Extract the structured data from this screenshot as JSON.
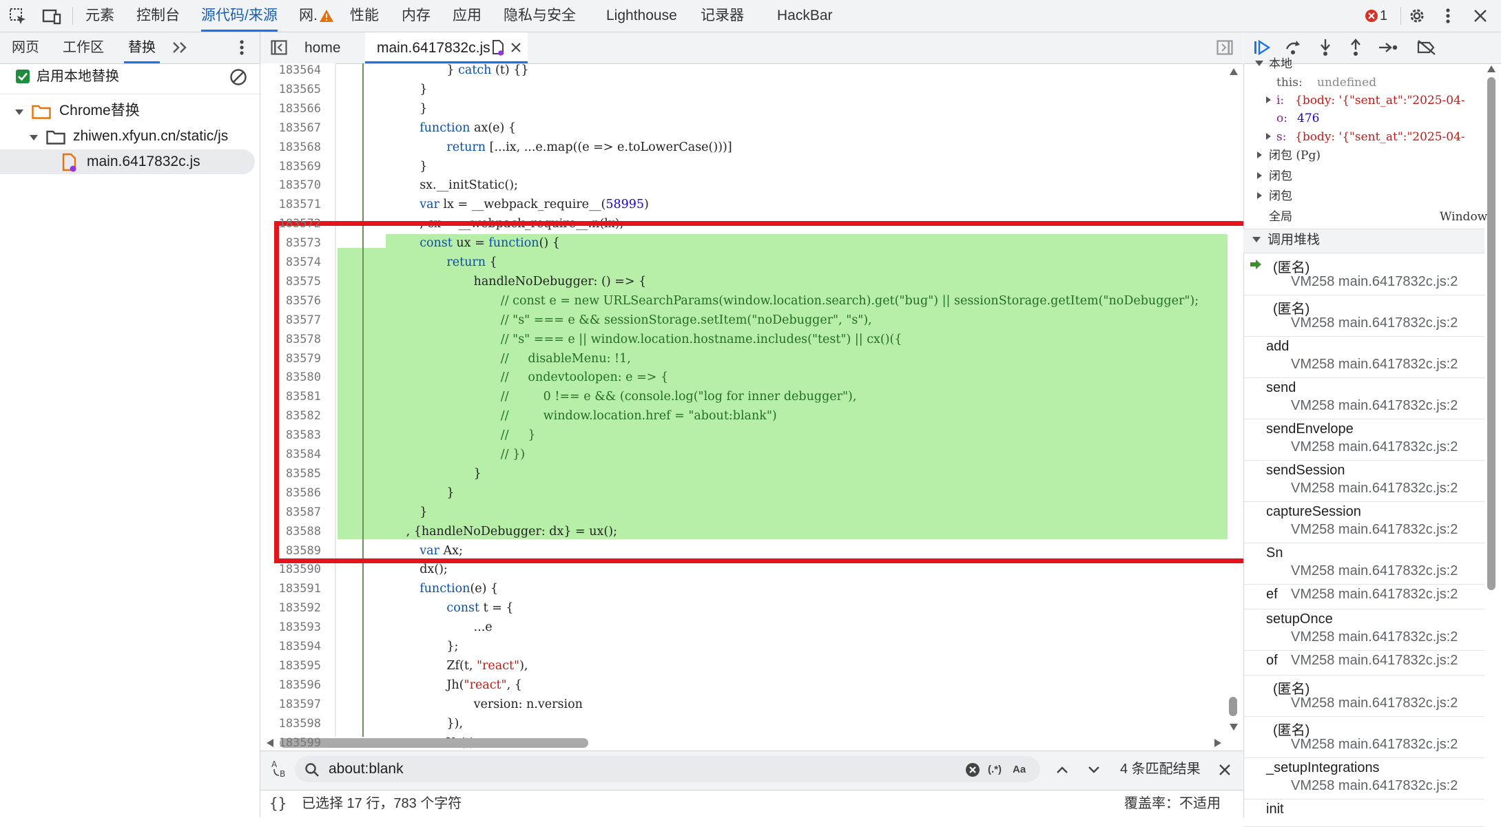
{
  "topbar": {
    "tabs": [
      "元素",
      "控制台",
      "源代码/来源",
      "网.",
      "性能",
      "内存",
      "应用",
      "隐私与安全",
      "Lighthouse",
      "记录器",
      "HackBar"
    ],
    "active_tab": "源代码/来源",
    "error_count": "1",
    "icons": [
      "inspect-icon",
      "device-toolbar-icon",
      "warning-icon",
      "error-icon",
      "settings-icon",
      "more-icon",
      "close-icon"
    ]
  },
  "sidebar": {
    "tabs": [
      "网页",
      "工作区",
      "替换"
    ],
    "active_tab": "替换",
    "enable_local_override": "启用本地替换",
    "tree": {
      "root": "Chrome替换",
      "folder": "zhiwen.xfyun.cn/static/js",
      "file": "main.6417832c.js"
    }
  },
  "editor": {
    "tabs": [
      "home",
      "main.6417832c.js"
    ],
    "active_tab": "main.6417832c.js",
    "lines": [
      {
        "n": "183564",
        "text": "} catch (t) {}"
      },
      {
        "n": "183565",
        "text": "}"
      },
      {
        "n": "183566",
        "text": "}"
      },
      {
        "n": "183567",
        "text": "function ax(e) {"
      },
      {
        "n": "183568",
        "text": "return [...ix, ...e.map((e => e.toLowerCase()))]"
      },
      {
        "n": "183569",
        "text": "}"
      },
      {
        "n": "183570",
        "text": "sx.__initStatic();"
      },
      {
        "n": "183571",
        "text": "var lx = __webpack_require__(58995)"
      },
      {
        "n": "183572",
        "text": ", cx = __webpack_require__.n(lx);"
      },
      {
        "n": "83573",
        "text": "const ux = function() {"
      },
      {
        "n": "83574",
        "text": "return {"
      },
      {
        "n": "83575",
        "text": "handleNoDebugger: () => {"
      },
      {
        "n": "83576",
        "text": "// const e = new URLSearchParams(window.location.search).get(\"bug\") || sessionStorage.getItem(\"noDebugger\");"
      },
      {
        "n": "83577",
        "text": "// \"s\" === e && sessionStorage.setItem(\"noDebugger\", \"s\"),"
      },
      {
        "n": "83578",
        "text": "// \"s\" === e || window.location.hostname.includes(\"test\") || cx()({"
      },
      {
        "n": "83579",
        "text": "//     disableMenu: !1,"
      },
      {
        "n": "83580",
        "text": "//     ondevtoolopen: e => {"
      },
      {
        "n": "83581",
        "text": "//         0 !== e && (console.log(\"log for inner debugger\"),"
      },
      {
        "n": "83582",
        "text": "//         window.location.href = \"about:blank\")"
      },
      {
        "n": "83583",
        "text": "//     }"
      },
      {
        "n": "83584",
        "text": "// })"
      },
      {
        "n": "83585",
        "text": "}"
      },
      {
        "n": "83586",
        "text": "}"
      },
      {
        "n": "83587",
        "text": "}"
      },
      {
        "n": "83588",
        "text": ", {handleNoDebugger: dx} = ux();"
      },
      {
        "n": "83589",
        "text": "var Ax;"
      },
      {
        "n": "183590",
        "text": "dx();"
      },
      {
        "n": "183591",
        "text": "function(e) {"
      },
      {
        "n": "183592",
        "text": "const t = {"
      },
      {
        "n": "183593",
        "text": "...e"
      },
      {
        "n": "183594",
        "text": "};"
      },
      {
        "n": "183595",
        "text": "Zf(t, \"react\"),"
      },
      {
        "n": "183596",
        "text": "Jh(\"react\", {"
      },
      {
        "n": "183597",
        "text": "version: n.version"
      },
      {
        "n": "183598",
        "text": "}),"
      },
      {
        "n": "183599",
        "text": "Yr(t)"
      }
    ]
  },
  "search": {
    "query": "about:blank",
    "regex_label": "(.*)",
    "case_label": "Aa",
    "match_count": "4 条匹配结果"
  },
  "status": {
    "selection": "已选择 17 行，783 个字符",
    "coverage": "覆盖率：不适用"
  },
  "scope": {
    "local_label": "本地",
    "this_key": "this:",
    "this_val": "undefined",
    "i_key": "i:",
    "i_val": "{body: '{\"sent_at\":\"2025-04-",
    "o_key": "o:",
    "o_val": "476",
    "s_key": "s:",
    "s_val": "{body: '{\"sent_at\":\"2025-04-",
    "closure_pg": "闭包 (Pg)",
    "closure1": "闭包",
    "closure2": "闭包",
    "global": "全局",
    "global_val": "Window"
  },
  "callstack": {
    "header": "调用堆栈",
    "frames": [
      {
        "name": "(匿名)",
        "loc": "VM258 main.6417832c.js:2"
      },
      {
        "name": "(匿名)",
        "loc": "VM258 main.6417832c.js:2"
      },
      {
        "name": "add",
        "loc": "VM258 main.6417832c.js:2"
      },
      {
        "name": "send",
        "loc": "VM258 main.6417832c.js:2"
      },
      {
        "name": "sendEnvelope",
        "loc": "VM258 main.6417832c.js:2"
      },
      {
        "name": "sendSession",
        "loc": "VM258 main.6417832c.js:2"
      },
      {
        "name": "captureSession",
        "loc": "VM258 main.6417832c.js:2"
      },
      {
        "name": "Sn",
        "loc": "VM258 main.6417832c.js:2"
      },
      {
        "name": "ef",
        "loc": "VM258 main.6417832c.js:2"
      },
      {
        "name": "setupOnce",
        "loc": "VM258 main.6417832c.js:2"
      },
      {
        "name": "of",
        "loc": "VM258 main.6417832c.js:2"
      },
      {
        "name": "(匿名)",
        "loc": "VM258 main.6417832c.js:2"
      },
      {
        "name": "(匿名)",
        "loc": "VM258 main.6417832c.js:2"
      },
      {
        "name": "_setupIntegrations",
        "loc": "VM258 main.6417832c.js:2"
      },
      {
        "name": "init",
        "loc": ""
      }
    ]
  }
}
